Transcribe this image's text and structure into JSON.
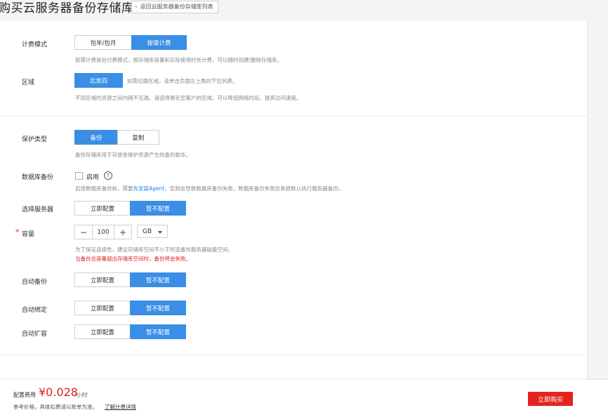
{
  "header": {
    "title": "购买云服务器备份存储库",
    "back_label": "返回云服务器备份存储库列表"
  },
  "billing": {
    "label": "计费模式",
    "options": [
      "包年/包月",
      "按需计费"
    ],
    "selected": "按需计费",
    "hint": "按需计费是后付费模式，按存储库容量和实际使用时长计费，可以随时创建/删除存储库。"
  },
  "region": {
    "label": "区域",
    "value": "北京四",
    "inline_hint": "如需切换区域，请单击页面左上角的下拉列表。",
    "hint": "不同区域的资源之间内网不互通。请选择靠近您客户的区域，可以降低网络时延、提高访问速度。"
  },
  "protection": {
    "label": "保护类型",
    "options": [
      "备份",
      "复制"
    ],
    "selected": "备份",
    "hint": "备份存储库用于存放受保护资源产生的备份副本。"
  },
  "db_backup": {
    "label": "数据库备份",
    "checkbox_label": "启用",
    "help_glyph": "?",
    "hint_prefix": "启用数据库备份前，需要",
    "hint_link": "先安装Agent",
    "hint_suffix": "，否则会导致数据库备份失败，数据库备份失败后系统默认执行服务器备份。"
  },
  "select_server": {
    "label": "选择服务器",
    "options": [
      "立即配置",
      "暂不配置"
    ],
    "selected": "暂不配置"
  },
  "capacity": {
    "required_mark": "*",
    "label": "容量",
    "minus": "−",
    "plus": "+",
    "value": "100",
    "unit": "GB",
    "hint": "为了保证连续性，建议存储库空间不小于所选备份服务器磁盘空间。",
    "warning": "当备份总容量超出存储库空间时，备份将会失败。"
  },
  "auto_backup": {
    "label": "自动备份",
    "options": [
      "立即配置",
      "暂不配置"
    ],
    "selected": "暂不配置"
  },
  "auto_bind": {
    "label": "自动绑定",
    "options": [
      "立即配置",
      "暂不配置"
    ],
    "selected": "暂不配置"
  },
  "auto_expand": {
    "label": "自动扩容",
    "options": [
      "立即配置",
      "暂不配置"
    ],
    "selected": "暂不配置"
  },
  "footer": {
    "fee_label": "配置费用",
    "price": "¥0.028",
    "unit": "/小时",
    "note": "参考价格，具体扣费请以账单为准。",
    "detail_link": "了解计费详情",
    "buy_label": "立即购买"
  },
  "colors": {
    "accent": "#3a8ee6",
    "price": "#e02020",
    "buy": "#e4231e"
  }
}
